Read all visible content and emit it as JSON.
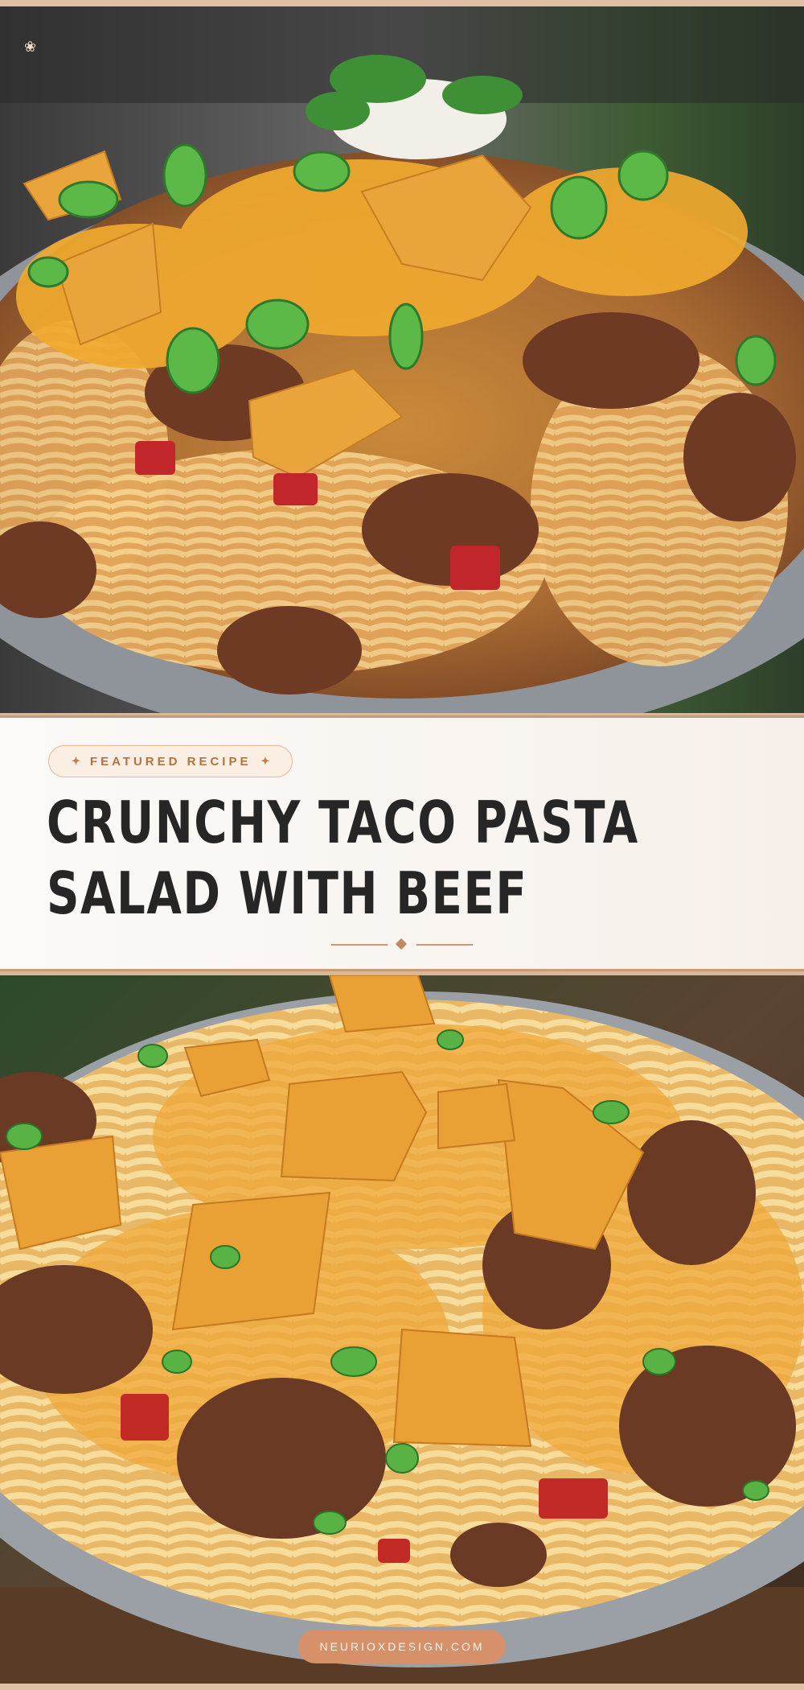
{
  "badge": {
    "spark_left": "✦",
    "label": "FEATURED RECIPE",
    "spark_right": "✦"
  },
  "title": {
    "line1": "CRUNCHY TACO PASTA",
    "line2": "SALAD WITH BEEF"
  },
  "footer": {
    "site": "NEURIOXDESIGN.COM"
  },
  "logo_icon": "snail-icon",
  "colors": {
    "accent": "#c79b78",
    "badge_text": "#b8703f",
    "title": "#262626",
    "pill": "#d6916a"
  }
}
